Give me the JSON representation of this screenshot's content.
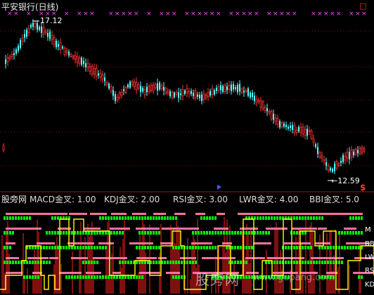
{
  "header": {
    "title": "平安银行(日线)",
    "corner_icon": "window-toggle-icon",
    "corner_text": "□"
  },
  "price_panel": {
    "max_label": "17.12",
    "min_label": "←12.59",
    "dollar_marker": "$"
  },
  "indicator_panel": {
    "source_label": "股旁网",
    "legend": [
      {
        "label": "MACD金叉: 1.00",
        "color": "#ff3030"
      },
      {
        "label": "KDJ金叉: 2.00",
        "color": "#ff3030"
      },
      {
        "label": "RSI金叉: 3.00",
        "color": "#ff3030"
      },
      {
        "label": "LWR金叉: 4.00",
        "color": "#ff3030"
      },
      {
        "label": "BBI金叉: 5.0",
        "color": "#ff3030"
      }
    ],
    "side_labels": [
      "M",
      "BB",
      "LW",
      "RS",
      "KD"
    ],
    "watermark": "股旁网",
    "watermark_url": "www.gupang.com"
  },
  "colors": {
    "up": "#ff3232",
    "down": "#54ffff",
    "grid": "#8a1010",
    "marker": "#ff40ff",
    "yellow": "#ffff00",
    "green": "#00ff00",
    "red_area": "#ff2020",
    "divider": "#b01010"
  }
}
